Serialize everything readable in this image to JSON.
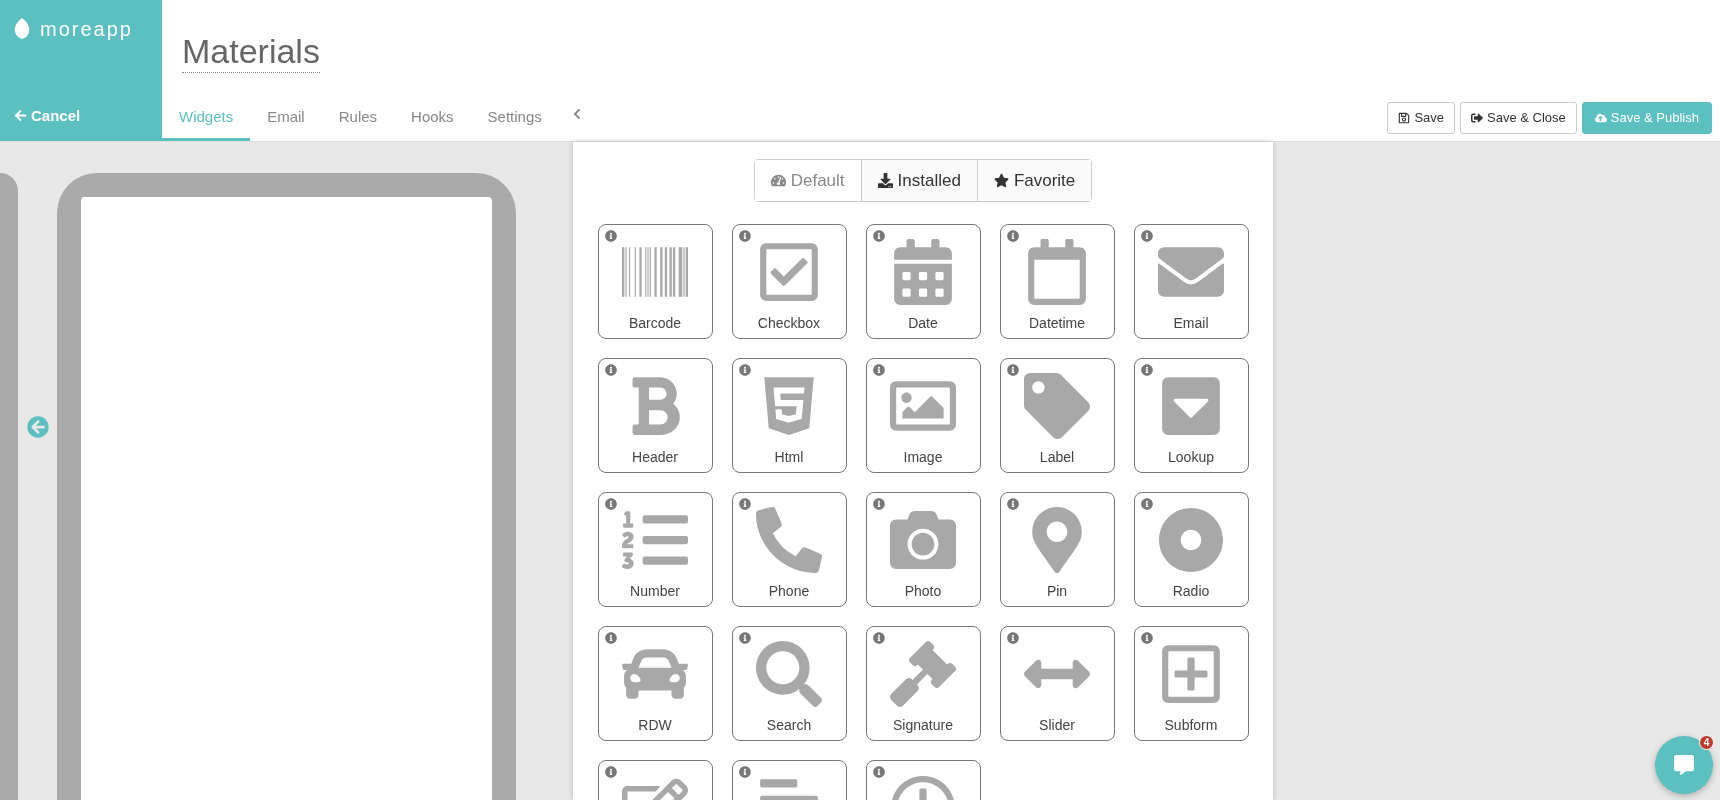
{
  "brand": {
    "name": "moreapp"
  },
  "cancel": {
    "label": "Cancel"
  },
  "form_title": "Materials",
  "tabs": [
    {
      "label": "Widgets",
      "selected": true
    },
    {
      "label": "Email",
      "selected": false
    },
    {
      "label": "Rules",
      "selected": false
    },
    {
      "label": "Hooks",
      "selected": false
    },
    {
      "label": "Settings",
      "selected": false
    }
  ],
  "actions": [
    {
      "label": "Save",
      "kind": "save"
    },
    {
      "label": "Save & Close",
      "kind": "close"
    },
    {
      "label": "Save & Publish",
      "kind": "publish"
    }
  ],
  "widget_filters": [
    {
      "label": "Default",
      "kind": "default",
      "selected": true
    },
    {
      "label": "Installed",
      "kind": "installed",
      "selected": false
    },
    {
      "label": "Favorite",
      "kind": "favorite",
      "selected": false
    }
  ],
  "widgets": [
    {
      "label": "Barcode",
      "kind": "barcode"
    },
    {
      "label": "Checkbox",
      "kind": "checkbox"
    },
    {
      "label": "Date",
      "kind": "date"
    },
    {
      "label": "Datetime",
      "kind": "datetime"
    },
    {
      "label": "Email",
      "kind": "email"
    },
    {
      "label": "Header",
      "kind": "header"
    },
    {
      "label": "Html",
      "kind": "html"
    },
    {
      "label": "Image",
      "kind": "image"
    },
    {
      "label": "Label",
      "kind": "label"
    },
    {
      "label": "Lookup",
      "kind": "lookup"
    },
    {
      "label": "Number",
      "kind": "number"
    },
    {
      "label": "Phone",
      "kind": "phone"
    },
    {
      "label": "Photo",
      "kind": "photo"
    },
    {
      "label": "Pin",
      "kind": "pin"
    },
    {
      "label": "Radio",
      "kind": "radio"
    },
    {
      "label": "RDW",
      "kind": "rdw"
    },
    {
      "label": "Search",
      "kind": "search"
    },
    {
      "label": "Signature",
      "kind": "signature"
    },
    {
      "label": "Slider",
      "kind": "slider"
    },
    {
      "label": "Subform",
      "kind": "subform"
    },
    {
      "kind": "edit"
    },
    {
      "kind": "lines"
    },
    {
      "kind": "clock"
    }
  ],
  "chat": {
    "badge": "4"
  }
}
